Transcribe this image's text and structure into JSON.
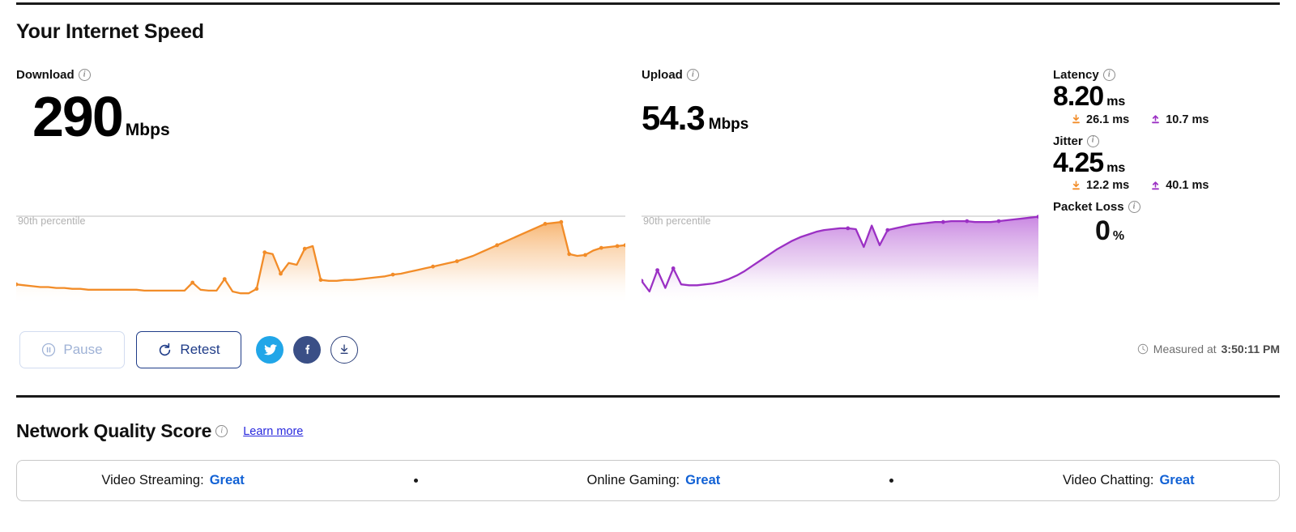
{
  "header": {
    "title": "Your Internet Speed"
  },
  "download": {
    "label": "Download",
    "value": "290",
    "unit": "Mbps",
    "percentile_label": "90th percentile",
    "color": "#f28c28"
  },
  "upload": {
    "label": "Upload",
    "value": "54.3",
    "unit": "Mbps",
    "percentile_label": "90th percentile",
    "color": "#9b30c4"
  },
  "stats": {
    "latency": {
      "label": "Latency",
      "value": "8.20",
      "unit": "ms",
      "down_value": "26.1 ms",
      "up_value": "10.7 ms"
    },
    "jitter": {
      "label": "Jitter",
      "value": "4.25",
      "unit": "ms",
      "down_value": "12.2 ms",
      "up_value": "40.1 ms"
    },
    "packet_loss": {
      "label": "Packet Loss",
      "value": "0",
      "unit": "%"
    }
  },
  "controls": {
    "pause_label": "Pause",
    "retest_label": "Retest",
    "twitter_name": "twitter-icon",
    "facebook_name": "facebook-icon",
    "download_name": "download-icon"
  },
  "measured": {
    "prefix": "Measured at",
    "time": "3:50:11 PM"
  },
  "network_quality": {
    "title": "Network Quality Score",
    "learn_more": "Learn more",
    "items": [
      {
        "label": "Video Streaming:",
        "rating": "Great"
      },
      {
        "label": "Online Gaming:",
        "rating": "Great"
      },
      {
        "label": "Video Chatting:",
        "rating": "Great"
      }
    ]
  },
  "chart_data": [
    {
      "type": "area",
      "name": "download",
      "title": "Download throughput over test",
      "ylabel": "Mbps",
      "color": "#f28c28",
      "percentile_line": {
        "label": "90th percentile",
        "y_fraction": 0.17
      },
      "grid": false,
      "legend": "none",
      "x": [
        0,
        1,
        2,
        3,
        4,
        5,
        6,
        7,
        8,
        9,
        10,
        11,
        12,
        13,
        14,
        15,
        16,
        17,
        18,
        19,
        20,
        21,
        22,
        23,
        24,
        25,
        26,
        27,
        28,
        29,
        30,
        31,
        32,
        33,
        34,
        35,
        36,
        37,
        38,
        39,
        40,
        41,
        42,
        43,
        44,
        45,
        46,
        47,
        48,
        49,
        50,
        51,
        52,
        53,
        54,
        55,
        56,
        57,
        58,
        59,
        60,
        61,
        62,
        63,
        64,
        65,
        66,
        67,
        68,
        69,
        70,
        71,
        72,
        73,
        74,
        75,
        76
      ],
      "values": [
        18,
        17,
        16,
        15,
        15,
        14,
        14,
        13,
        13,
        12,
        12,
        12,
        12,
        12,
        12,
        12,
        11,
        11,
        11,
        11,
        11,
        11,
        20,
        12,
        11,
        11,
        24,
        10,
        8,
        8,
        13,
        54,
        52,
        30,
        42,
        40,
        58,
        61,
        23,
        22,
        22,
        23,
        23,
        24,
        25,
        26,
        27,
        29,
        30,
        32,
        34,
        36,
        38,
        40,
        42,
        44,
        47,
        50,
        54,
        58,
        62,
        66,
        70,
        74,
        78,
        82,
        86,
        87,
        88,
        52,
        50,
        51,
        56,
        59,
        60,
        61,
        62
      ],
      "markers_x": [
        0,
        22,
        26,
        30,
        31,
        33,
        36,
        38,
        47,
        52,
        55,
        60,
        66,
        68,
        69,
        71,
        73,
        75,
        76
      ],
      "ylim": [
        0,
        100
      ]
    },
    {
      "type": "area",
      "name": "upload",
      "title": "Upload throughput over test",
      "ylabel": "Mbps",
      "color": "#9b30c4",
      "percentile_line": {
        "label": "90th percentile",
        "y_fraction": 0.17
      },
      "grid": false,
      "legend": "none",
      "x": [
        0,
        1,
        2,
        3,
        4,
        5,
        6,
        7,
        8,
        9,
        10,
        11,
        12,
        13,
        14,
        15,
        16,
        17,
        18,
        19,
        20,
        21,
        22,
        23,
        24,
        25,
        26,
        27,
        28,
        29,
        30,
        31,
        32,
        33,
        34,
        35,
        36,
        37,
        38,
        39,
        40,
        41,
        42,
        43,
        44,
        45,
        46,
        47,
        48,
        49,
        50
      ],
      "values": [
        22,
        10,
        34,
        14,
        36,
        18,
        17,
        17,
        18,
        19,
        21,
        24,
        28,
        33,
        39,
        45,
        51,
        57,
        62,
        67,
        71,
        74,
        77,
        79,
        80,
        81,
        81,
        80,
        60,
        84,
        62,
        79,
        81,
        83,
        85,
        86,
        87,
        88,
        88,
        89,
        89,
        89,
        88,
        88,
        88,
        89,
        90,
        91,
        92,
        93,
        94
      ],
      "markers_x": [
        0,
        2,
        4,
        26,
        31,
        38,
        41,
        45,
        50
      ],
      "ylim": [
        0,
        100
      ]
    }
  ]
}
